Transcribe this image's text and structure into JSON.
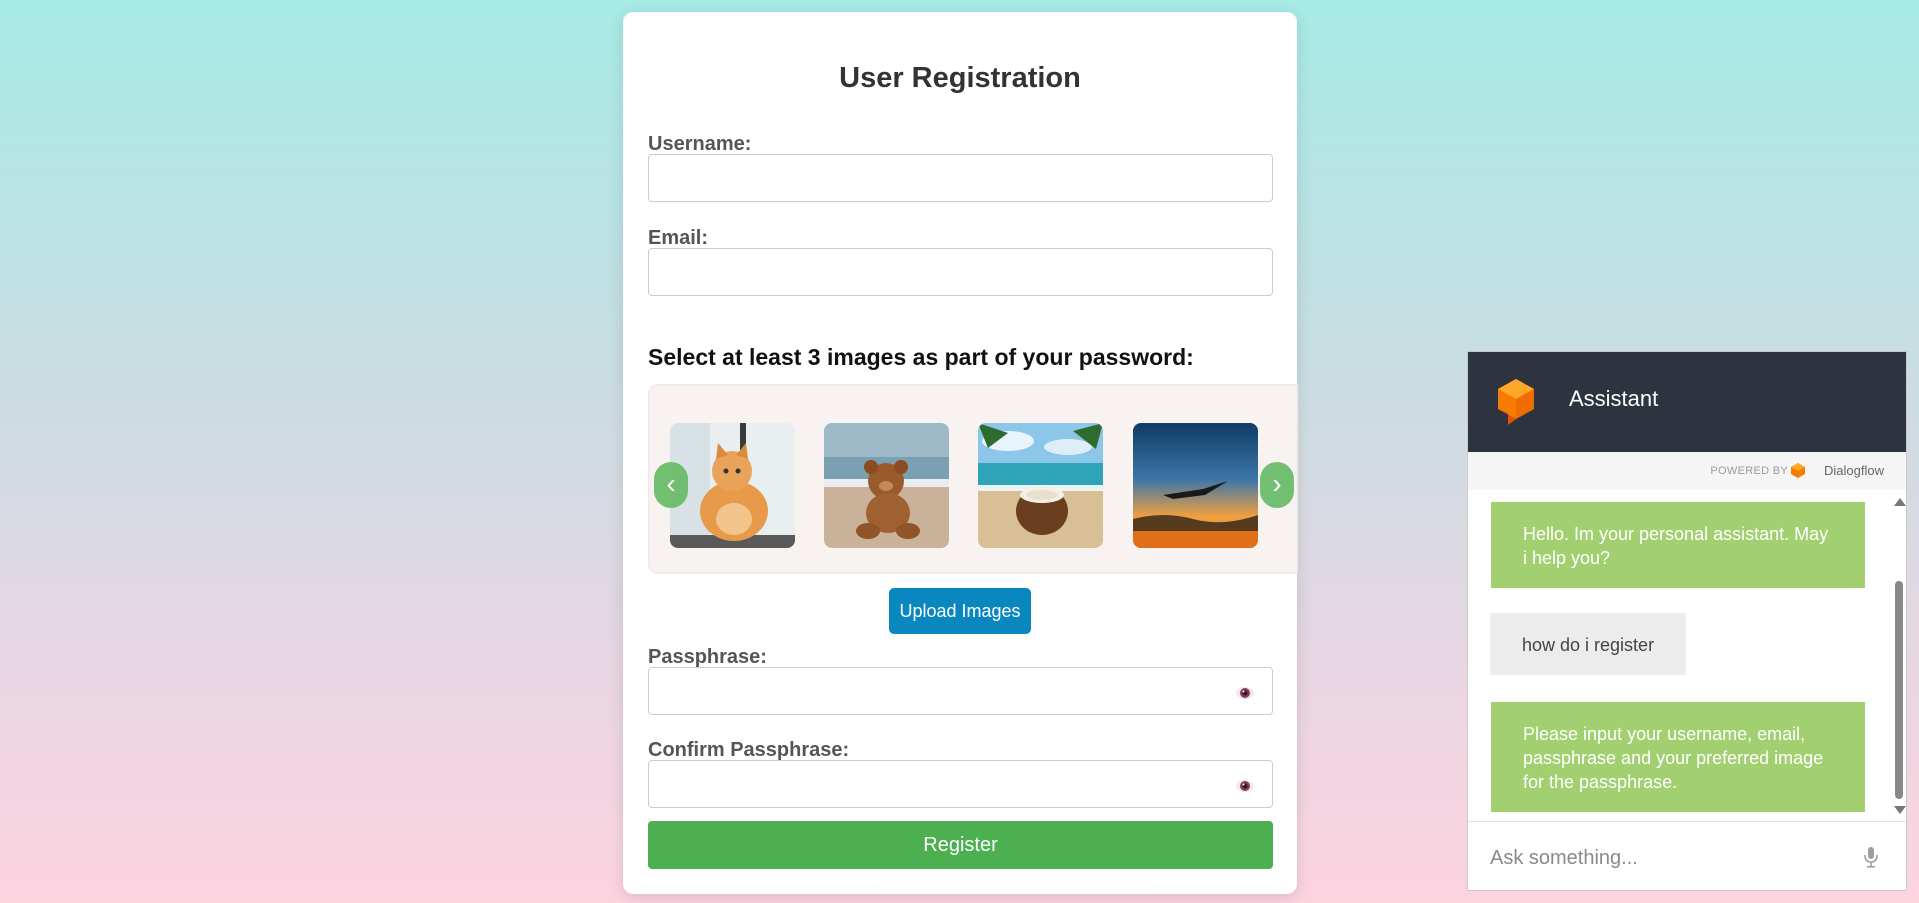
{
  "form": {
    "title": "User Registration",
    "username_label": "Username:",
    "username_value": "",
    "email_label": "Email:",
    "email_value": "",
    "images_title": "Select at least 3 images as part of your password:",
    "carousel_prev": "‹",
    "carousel_next": "›",
    "images": [
      {
        "name": "cat-image",
        "icon": "orange-cat-photo"
      },
      {
        "name": "teddy-bear-image",
        "icon": "teddy-bear-on-beach-photo"
      },
      {
        "name": "coconut-image",
        "icon": "coconut-on-beach-photo"
      },
      {
        "name": "sunset-image",
        "icon": "sunset-plane-photo"
      }
    ],
    "upload_label": "Upload Images",
    "passphrase_label": "Passphrase:",
    "passphrase_value": "",
    "confirm_label": "Confirm Passphrase:",
    "confirm_value": "",
    "register_label": "Register",
    "colors": {
      "register": "#4caf50",
      "upload": "#0b87c0",
      "arrow": "#6cbd6c"
    }
  },
  "chat": {
    "title": "Assistant",
    "powered_by": "POWERED BY",
    "provider": "Dialogflow",
    "messages": [
      {
        "from": "bot",
        "text": "Hello. Im your personal assistant. May i help you?"
      },
      {
        "from": "user",
        "text": "how do i register"
      },
      {
        "from": "bot",
        "text": "Please input your username, email, passphrase and your preferred image for the passphrase."
      }
    ],
    "input_placeholder": "Ask something...",
    "colors": {
      "header": "#2e3340",
      "bot_bubble": "#a2d071",
      "user_bubble": "#ececec",
      "logo": "#f57c00"
    }
  }
}
